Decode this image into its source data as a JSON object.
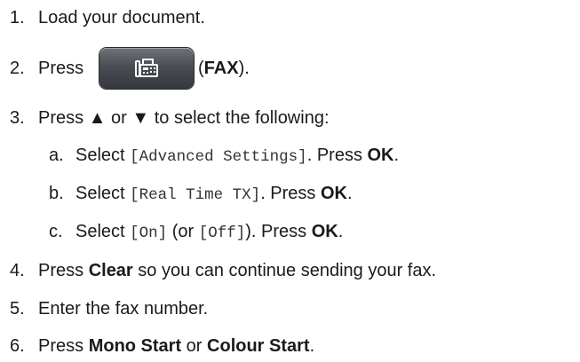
{
  "steps": [
    {
      "num": "1.",
      "text": "Load your document."
    },
    {
      "num": "2.",
      "pre": "Press",
      "icon": "fax-icon",
      "open": " (",
      "bold": "FAX",
      "close": ")."
    },
    {
      "num": "3.",
      "text": "Press ▲ or ▼ to select the following:"
    },
    {
      "num": "4.",
      "pre": "Press ",
      "bold": "Clear",
      "post": " so you can continue sending your fax."
    },
    {
      "num": "5.",
      "text": "Enter the fax number."
    },
    {
      "num": "6.",
      "pre": "Press ",
      "bold1": "Mono Start",
      "mid": " or ",
      "bold2": "Colour Start",
      "post": "."
    }
  ],
  "substeps": [
    {
      "num": "a.",
      "pre": "Select ",
      "code": "[Advanced Settings]",
      "mid": ". Press ",
      "bold": "OK",
      "post": "."
    },
    {
      "num": "b.",
      "pre": "Select ",
      "code": "[Real Time TX]",
      "mid": ". Press ",
      "bold": "OK",
      "post": "."
    },
    {
      "num": "c.",
      "pre": "Select ",
      "code": "[On]",
      "mid1": " (or ",
      "code2": "[Off]",
      "mid": "). Press ",
      "bold": "OK",
      "post": "."
    }
  ],
  "colors": {
    "button_top": "#6f7278",
    "button_bottom": "#35383d",
    "icon": "#ffffff"
  }
}
